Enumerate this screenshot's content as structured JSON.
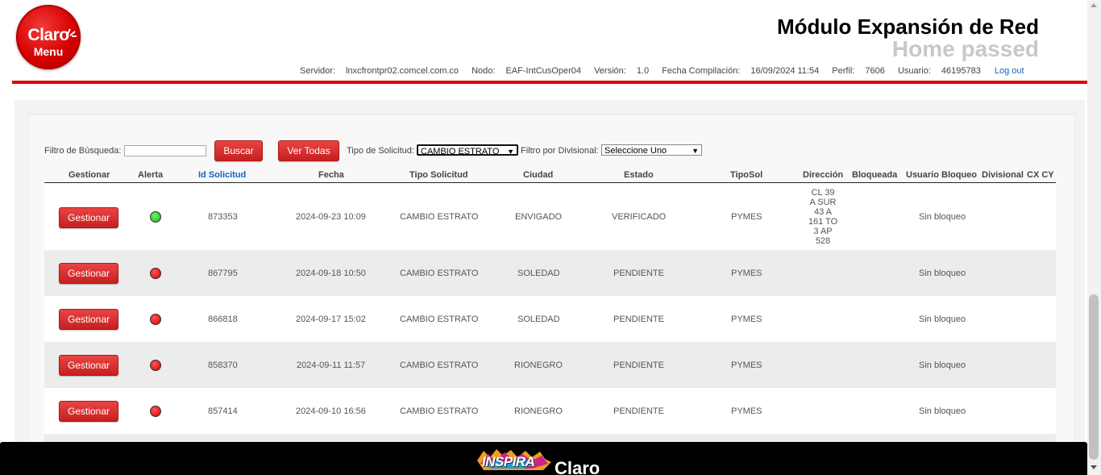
{
  "logo": {
    "brand": "Claro",
    "menu": "Menu"
  },
  "header": {
    "title": "Módulo Expansión de Red",
    "subtitle": "Home passed"
  },
  "info": {
    "servidor_label": "Servidor:",
    "servidor": "lnxcfrontpr02.comcel.com.co",
    "nodo_label": "Nodo:",
    "nodo": "EAF-IntCusOper04",
    "version_label": "Versión:",
    "version": "1.0",
    "fecha_label": "Fecha Compilación:",
    "fecha": "16/09/2024 11:54",
    "perfil_label": "Perfil:",
    "perfil": "7606",
    "usuario_label": "Usuario:",
    "usuario": "46195783",
    "logout": "Log out"
  },
  "filters": {
    "search_label": "Filtro de Búsqueda:",
    "search_value": "",
    "buscar": "Buscar",
    "ver_todas": "Ver Todas",
    "tipo_label": "Tipo de Solicitud:",
    "tipo_value": "CAMBIO ESTRATO",
    "divisional_label": "Filtro por Divisional:",
    "divisional_value": "Seleccione Uno"
  },
  "table": {
    "headers": {
      "gestionar": "Gestionar",
      "alerta": "Alerta",
      "id": "Id Solicitud",
      "fecha": "Fecha",
      "tipo": "Tipo Solicitud",
      "ciudad": "Ciudad",
      "estado": "Estado",
      "tiposol": "TipoSol",
      "direccion": "Dirección",
      "bloqueada": "Bloqueada",
      "usuario": "Usuario Bloqueo",
      "divisional": "Divisional",
      "cxcy": "CX CY"
    },
    "button_label": "Gestionar",
    "rows": [
      {
        "alert": "green",
        "id": "873353",
        "fecha": "2024-09-23 10:09",
        "tipo": "CAMBIO ESTRATO",
        "ciudad": "ENVIGADO",
        "estado": "VERIFICADO",
        "tiposol": "PYMES",
        "direccion": [
          "CL 39",
          "A SUR",
          "43 A",
          "161 TO",
          "3 AP",
          "528"
        ],
        "usuario": "Sin bloqueo"
      },
      {
        "alert": "red",
        "id": "867795",
        "fecha": "2024-09-18 10:50",
        "tipo": "CAMBIO ESTRATO",
        "ciudad": "SOLEDAD",
        "estado": "PENDIENTE",
        "tiposol": "PYMES",
        "direccion": [],
        "usuario": "Sin bloqueo"
      },
      {
        "alert": "red",
        "id": "866818",
        "fecha": "2024-09-17 15:02",
        "tipo": "CAMBIO ESTRATO",
        "ciudad": "SOLEDAD",
        "estado": "PENDIENTE",
        "tiposol": "PYMES",
        "direccion": [],
        "usuario": "Sin bloqueo"
      },
      {
        "alert": "red",
        "id": "858370",
        "fecha": "2024-09-11 11:57",
        "tipo": "CAMBIO ESTRATO",
        "ciudad": "RIONEGRO",
        "estado": "PENDIENTE",
        "tiposol": "PYMES",
        "direccion": [],
        "usuario": "Sin bloqueo"
      },
      {
        "alert": "red",
        "id": "857414",
        "fecha": "2024-09-10 16:56",
        "tipo": "CAMBIO ESTRATO",
        "ciudad": "RIONEGRO",
        "estado": "PENDIENTE",
        "tiposol": "PYMES",
        "direccion": [],
        "usuario": "Sin bloqueo"
      }
    ]
  },
  "footer": {
    "inspira": "INSPIRA",
    "brand": "Claro"
  },
  "colors": {
    "accent_red": "#e30000",
    "link_blue": "#1565c0",
    "alert_green": "#17b617",
    "alert_red": "#d40000"
  }
}
